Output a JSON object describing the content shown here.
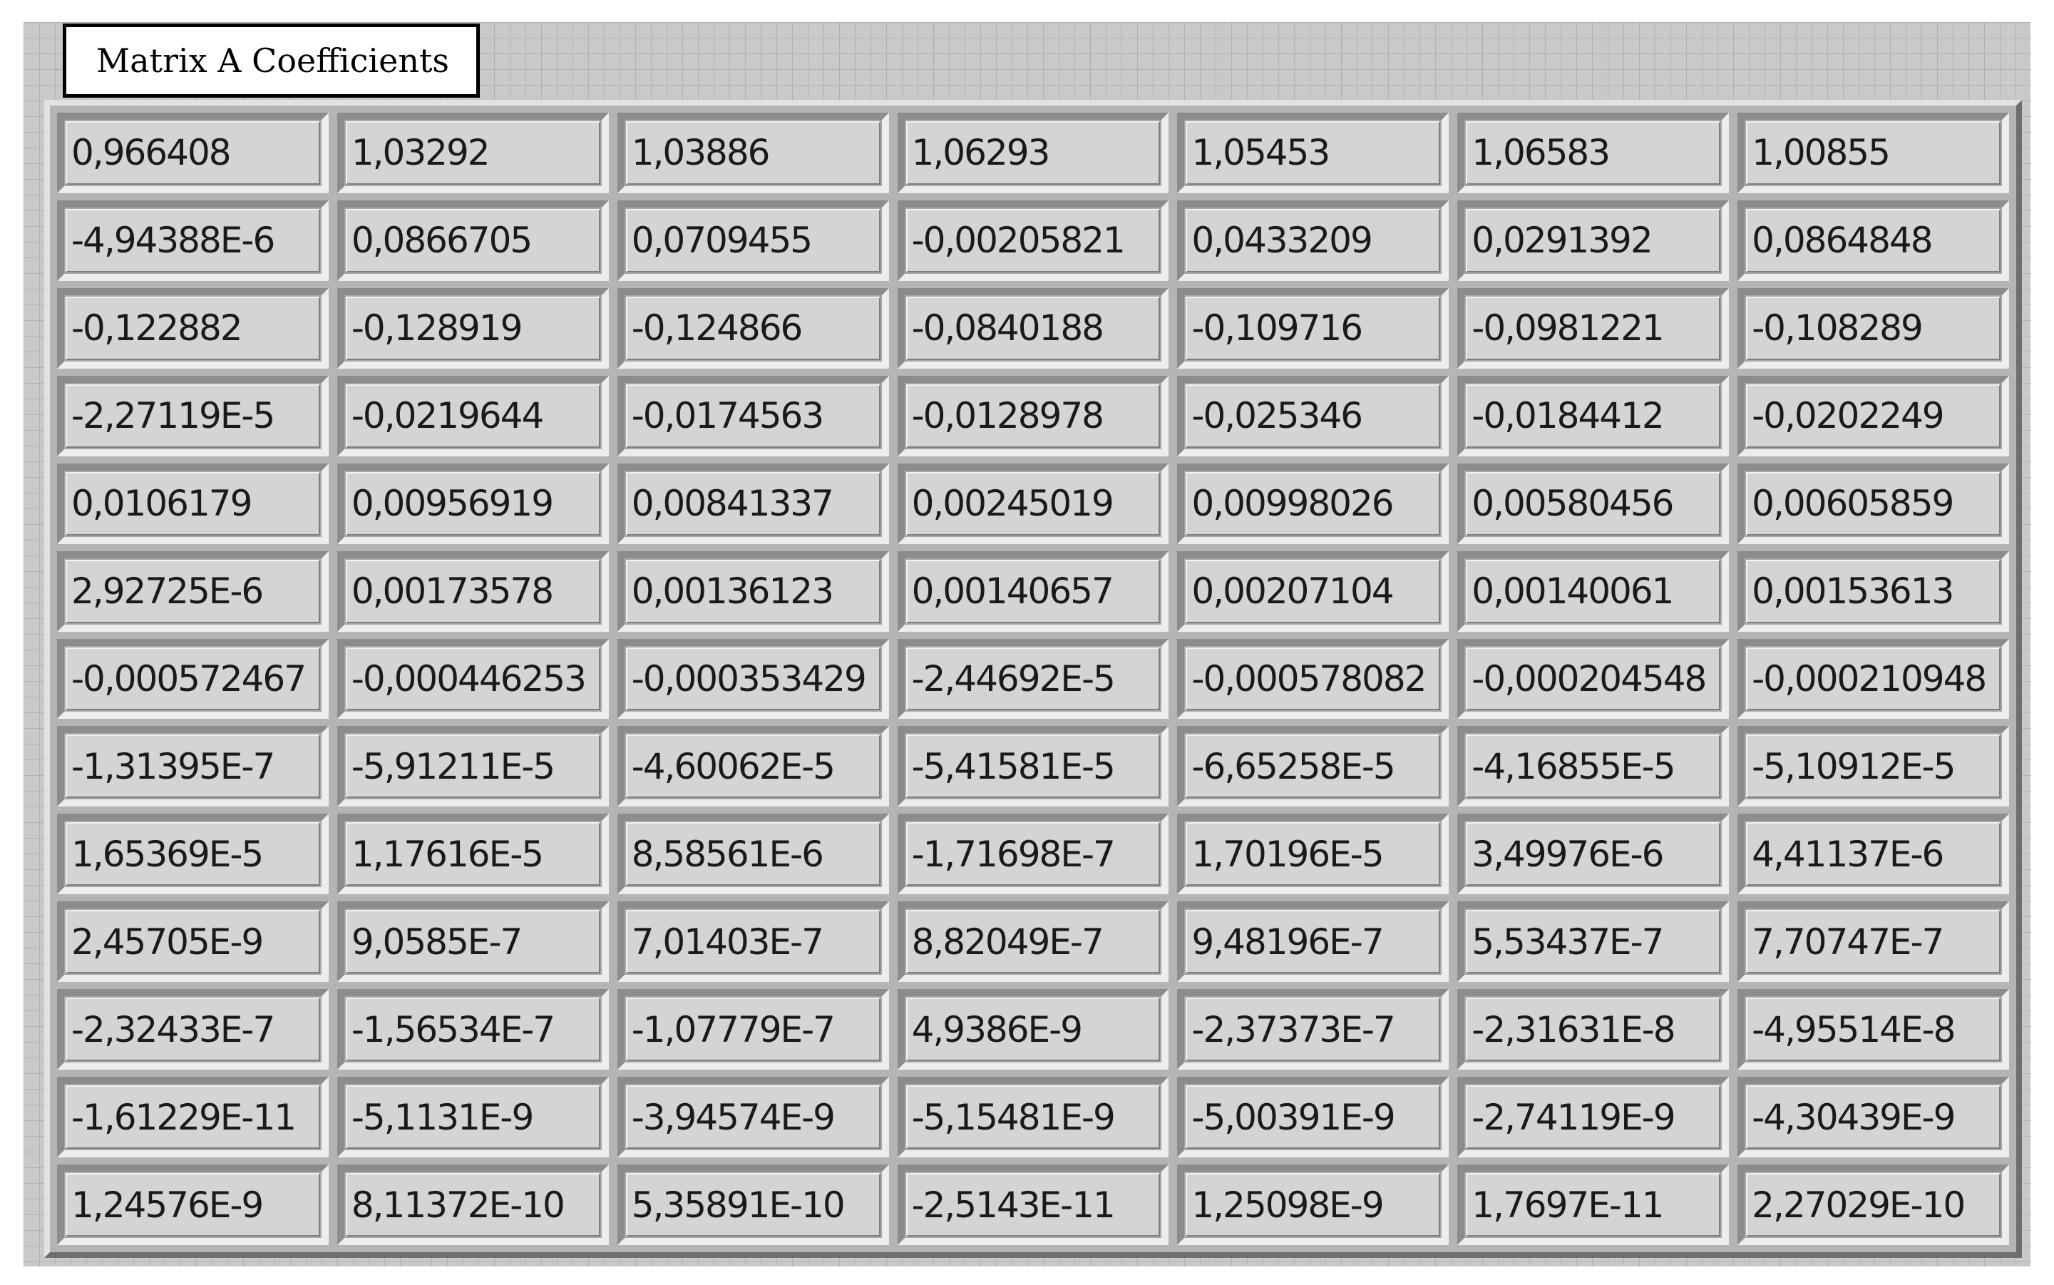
{
  "title": "Matrix A Coefficients",
  "colors": {
    "panel_background": "#c9c9c9",
    "cell_background": "#d4d4d4",
    "text": "#1a1a1a"
  },
  "matrix": {
    "rows": [
      [
        "0,966408",
        "1,03292",
        "1,03886",
        "1,06293",
        "1,05453",
        "1,06583",
        "1,00855"
      ],
      [
        "-4,94388E-6",
        "0,0866705",
        "0,0709455",
        "-0,00205821",
        "0,0433209",
        "0,0291392",
        "0,0864848"
      ],
      [
        "-0,122882",
        "-0,128919",
        "-0,124866",
        "-0,0840188",
        "-0,109716",
        "-0,0981221",
        "-0,108289"
      ],
      [
        "-2,27119E-5",
        "-0,0219644",
        "-0,0174563",
        "-0,0128978",
        "-0,025346",
        "-0,0184412",
        "-0,0202249"
      ],
      [
        "0,0106179",
        "0,00956919",
        "0,00841337",
        "0,00245019",
        "0,00998026",
        "0,00580456",
        "0,00605859"
      ],
      [
        "2,92725E-6",
        "0,00173578",
        "0,00136123",
        "0,00140657",
        "0,00207104",
        "0,00140061",
        "0,00153613"
      ],
      [
        "-0,000572467",
        "-0,000446253",
        "-0,000353429",
        "-2,44692E-5",
        "-0,000578082",
        "-0,000204548",
        "-0,000210948"
      ],
      [
        "-1,31395E-7",
        "-5,91211E-5",
        "-4,60062E-5",
        "-5,41581E-5",
        "-6,65258E-5",
        "-4,16855E-5",
        "-5,10912E-5"
      ],
      [
        "1,65369E-5",
        "1,17616E-5",
        "8,58561E-6",
        "-1,71698E-7",
        "1,70196E-5",
        "3,49976E-6",
        "4,41137E-6"
      ],
      [
        "2,45705E-9",
        "9,0585E-7",
        "7,01403E-7",
        "8,82049E-7",
        "9,48196E-7",
        "5,53437E-7",
        "7,70747E-7"
      ],
      [
        "-2,32433E-7",
        "-1,56534E-7",
        "-1,07779E-7",
        "4,9386E-9",
        "-2,37373E-7",
        "-2,31631E-8",
        "-4,95514E-8"
      ],
      [
        "-1,61229E-11",
        "-5,1131E-9",
        "-3,94574E-9",
        "-5,15481E-9",
        "-5,00391E-9",
        "-2,74119E-9",
        "-4,30439E-9"
      ],
      [
        "1,24576E-9",
        "8,11372E-10",
        "5,35891E-10",
        "-2,5143E-11",
        "1,25098E-9",
        "1,7697E-11",
        "2,27029E-10"
      ]
    ]
  }
}
